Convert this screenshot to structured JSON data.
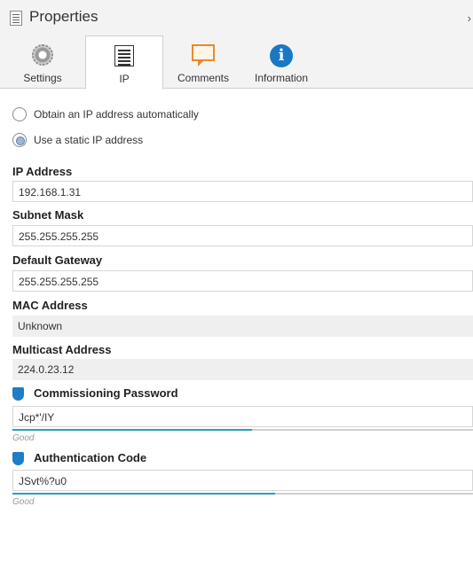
{
  "panel": {
    "title": "Properties",
    "close_glyph": "›"
  },
  "tabs": [
    {
      "label": "Settings",
      "icon": "gear-icon"
    },
    {
      "label": "IP",
      "icon": "ip-document-icon",
      "active": true
    },
    {
      "label": "Comments",
      "icon": "comment-icon"
    },
    {
      "label": "Information",
      "icon": "info-icon"
    }
  ],
  "ip_mode": {
    "options": [
      {
        "label": "Obtain an IP address automatically",
        "selected": false
      },
      {
        "label": "Use a static IP address",
        "selected": true
      }
    ]
  },
  "fields": {
    "ip_address": {
      "label": "IP Address",
      "value": "192.168.1.31"
    },
    "subnet_mask": {
      "label": "Subnet Mask",
      "value": "255.255.255.255"
    },
    "default_gateway": {
      "label": "Default Gateway",
      "value": "255.255.255.255"
    },
    "mac_address": {
      "label": "MAC Address",
      "value": "Unknown"
    },
    "multicast_address": {
      "label": "Multicast Address",
      "value": "224.0.23.12"
    },
    "commissioning_password": {
      "label": "Commissioning Password",
      "value": "Jcp*'/IY",
      "strength_label": "Good",
      "strength": 0.52
    },
    "authentication_code": {
      "label": "Authentication Code",
      "value": "JSvt%?u0",
      "strength_label": "Good",
      "strength": 0.57
    }
  },
  "colors": {
    "accent": "#1e7cc8",
    "strength_bar": "#2aa1b7",
    "comment_icon": "#e88a2c"
  }
}
